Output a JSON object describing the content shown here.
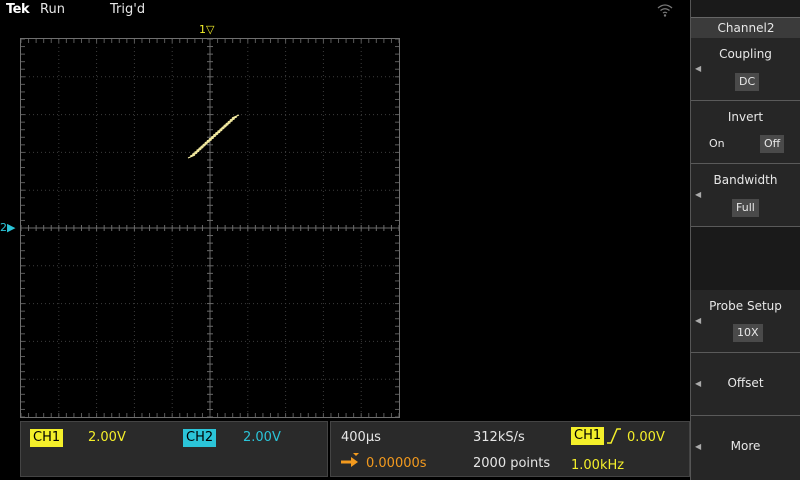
{
  "status": {
    "brand": "Tek",
    "run_state": "Run",
    "trigger_state": "Trig'd"
  },
  "icons": {
    "wifi": "wifi-icon",
    "network": "network-icon",
    "export": "export-icon",
    "help": "help-icon",
    "help_glyph": "?"
  },
  "markers": {
    "trigger_position": "1▽",
    "ch2_ground": "2▶"
  },
  "channels": {
    "ch1_label": "CH1",
    "ch1_scale": "2.00V",
    "ch2_label": "CH2",
    "ch2_scale": "2.00V"
  },
  "timebase": {
    "horizontal_scale": "400µs",
    "sample_rate": "312kS/s",
    "record_length": "2000 points",
    "delay": "0.00000s",
    "trigger_source": "CH1",
    "trigger_level": "0.00V",
    "trigger_frequency": "1.00kHz"
  },
  "menu": {
    "title": "Channel2",
    "coupling_label": "Coupling",
    "coupling_value": "DC",
    "invert_label": "Invert",
    "invert_on": "On",
    "invert_off": "Off",
    "bandwidth_label": "Bandwidth",
    "bandwidth_value": "Full",
    "probe_label": "Probe Setup",
    "probe_value": "10X",
    "offset_label": "Offset",
    "more_label": "More"
  },
  "colors": {
    "ch1": "#f4ef2a",
    "ch2": "#2bc4d8",
    "accent_orange": "#f39a1e"
  }
}
